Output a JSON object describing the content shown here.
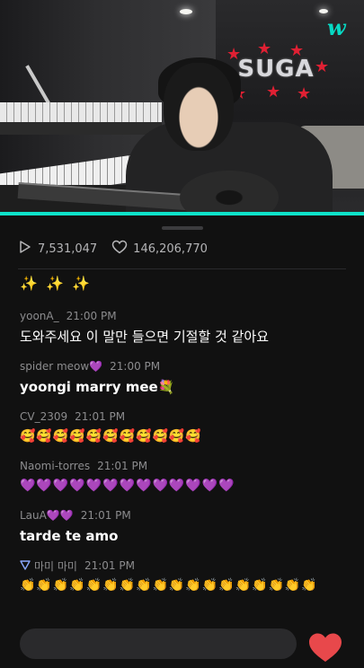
{
  "video": {
    "logo": "w",
    "sign_text": "SUGA",
    "progress_percent": 100,
    "accent_color": "#0ee3c9"
  },
  "stats": {
    "plays": "7,531,047",
    "likes": "146,206,770"
  },
  "chat": {
    "header_emoji": "✨ ✨ ✨",
    "comments": [
      {
        "user": "yoonA_",
        "time": "21:00 PM",
        "text": "도와주세요 이 말만 들으면 기절할 것 같아요"
      },
      {
        "user": "spider meow💜",
        "time": "21:00 PM",
        "text": "yoongi marry mee💐"
      },
      {
        "user": "CV_2309",
        "time": "21:01 PM",
        "text": "🥰🥰🥰🥰🥰🥰🥰🥰🥰🥰🥰"
      },
      {
        "user": "Naomi-torres",
        "time": "21:01 PM",
        "text": "💜💜💜💜💜💜💜💜💜💜💜💜💜"
      },
      {
        "user": "LauA💜💜",
        "time": "21:01 PM",
        "text": "tarde te amo"
      },
      {
        "user": "마미 마미",
        "time": "21:01 PM",
        "text": "👏👏👏👏👏👏👏👏👏👏👏👏👏👏👏👏👏👏"
      }
    ]
  },
  "icons": {
    "play": "play-icon",
    "like": "heart-outline-icon",
    "send_heart": "heart-icon"
  },
  "colors": {
    "background": "#111111",
    "heart": "#e8484b",
    "teal": "#0ee3c9"
  }
}
